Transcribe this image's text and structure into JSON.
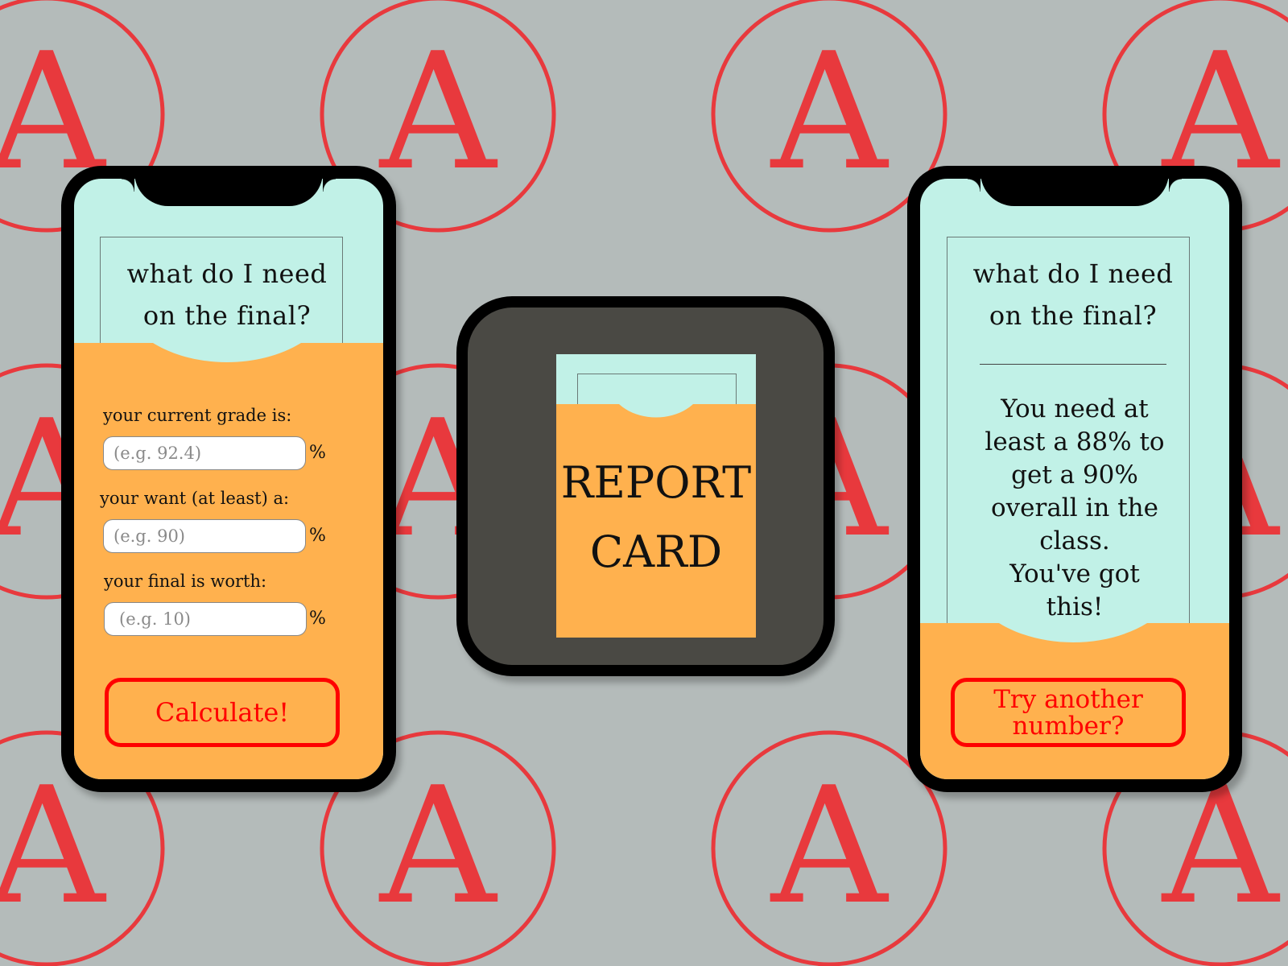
{
  "colors": {
    "background": "#b4bbba",
    "stamp": "#e8393d",
    "mint": "#c1f1e7",
    "orange": "#ffb14e",
    "button_border": "#ff0000",
    "icon_bg": "#4a4944"
  },
  "background_pattern": {
    "letter": "A"
  },
  "left_phone": {
    "title_line1": "what do I need",
    "title_line2": "on the final?",
    "fields": [
      {
        "label": "your current grade is:",
        "placeholder": "(e.g. 92.4)",
        "unit": "%"
      },
      {
        "label": "your want (at least) a:",
        "placeholder": "(e.g. 90)",
        "unit": "%"
      },
      {
        "label": "your final is worth:",
        "placeholder": "(e.g. 10)",
        "unit": "%"
      }
    ],
    "button_label": "Calculate!"
  },
  "app_icon": {
    "line1": "REPORT",
    "line2": "CARD"
  },
  "right_phone": {
    "title_line1": "what do I need",
    "title_line2": "on the final?",
    "result_line1": "You need at",
    "result_line2": "least a 88% to",
    "result_line3": "get a 90%",
    "result_line4": "overall in the",
    "result_line5": "class.",
    "result_line6": "You've got",
    "result_line7": "this!",
    "button_line1": "Try another",
    "button_line2": "number?"
  }
}
